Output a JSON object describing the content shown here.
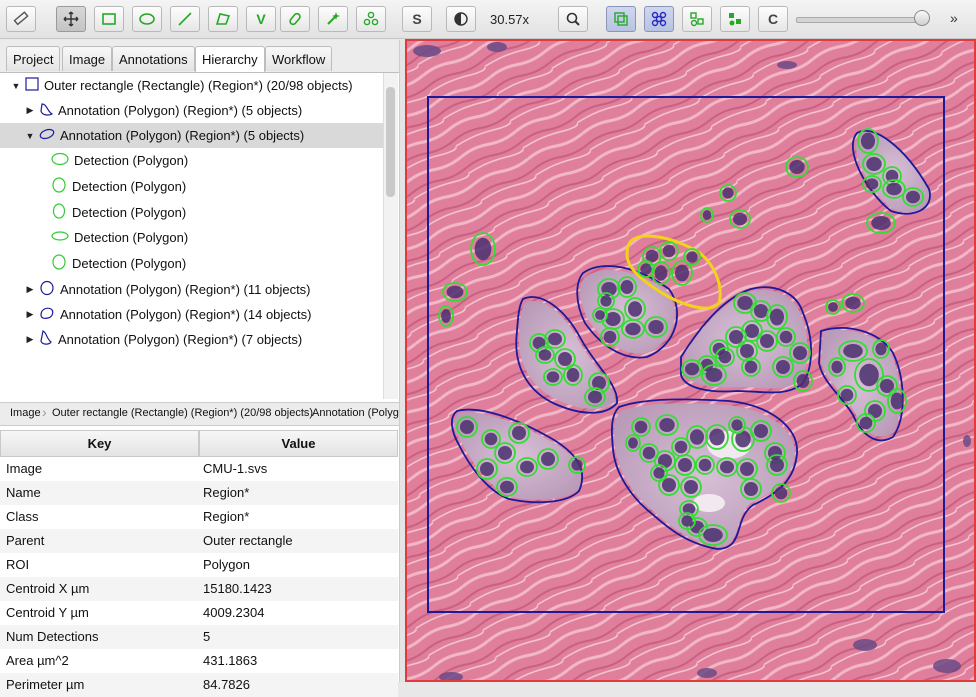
{
  "toolbar": {
    "zoom": "30.57x",
    "s_label": "S",
    "c_label": "C",
    "point_label": "V",
    "more": "»",
    "accent": "#27a827",
    "selected_accent": "#2a2ac4"
  },
  "tabs": [
    "Project",
    "Image",
    "Annotations",
    "Hierarchy",
    "Workflow"
  ],
  "tree": [
    {
      "label": "Outer rectangle (Rectangle) (Region*) (20/98 objects)",
      "icon": "rectangle-icon",
      "arrow": "▼"
    },
    {
      "label": "Annotation (Polygon) (Region*) (5 objects)",
      "icon": "polygon-icon",
      "arrow": "▶"
    },
    {
      "label": "Annotation (Polygon) (Region*) (5 objects)",
      "icon": "polygon-icon",
      "arrow": "▼"
    },
    {
      "label": "Detection (Polygon)",
      "icon": "detection-icon"
    },
    {
      "label": "Detection (Polygon)",
      "icon": "detection-icon"
    },
    {
      "label": "Detection (Polygon)",
      "icon": "detection-icon"
    },
    {
      "label": "Detection (Polygon)",
      "icon": "detection-icon"
    },
    {
      "label": "Detection (Polygon)",
      "icon": "detection-icon"
    },
    {
      "label": "Annotation (Polygon) (Region*) (11 objects)",
      "icon": "polygon-icon",
      "arrow": "▶"
    },
    {
      "label": "Annotation (Polygon) (Region*) (14 objects)",
      "icon": "polygon-icon",
      "arrow": "▶"
    },
    {
      "label": "Annotation (Polygon) (Region*) (7 objects)",
      "icon": "polygon-icon",
      "arrow": "▶"
    }
  ],
  "breadcrumb": [
    "Image",
    "Outer rectangle (Rectangle) (Region*) (20/98 objects)",
    "Annotation (Polygo"
  ],
  "table": {
    "headers": [
      "Key",
      "Value"
    ],
    "rows": [
      [
        "Image",
        "CMU-1.svs"
      ],
      [
        "Name",
        "Region*"
      ],
      [
        "Class",
        "Region*"
      ],
      [
        "Parent",
        "Outer rectangle"
      ],
      [
        "ROI",
        "Polygon"
      ],
      [
        "Centroid X µm",
        "15180.1423"
      ],
      [
        "Centroid Y µm",
        "4009.2304"
      ],
      [
        "Num Detections",
        "5"
      ],
      [
        "Area µm^2",
        "431.1863"
      ],
      [
        "Perimeter µm",
        "84.7826"
      ]
    ]
  },
  "colors": {
    "tissue": "#e58aa4",
    "annotation": "#1a1a9a",
    "detection": "#33dd33",
    "selected": "#f2d21b",
    "viewer_border": "#e03c3c"
  }
}
